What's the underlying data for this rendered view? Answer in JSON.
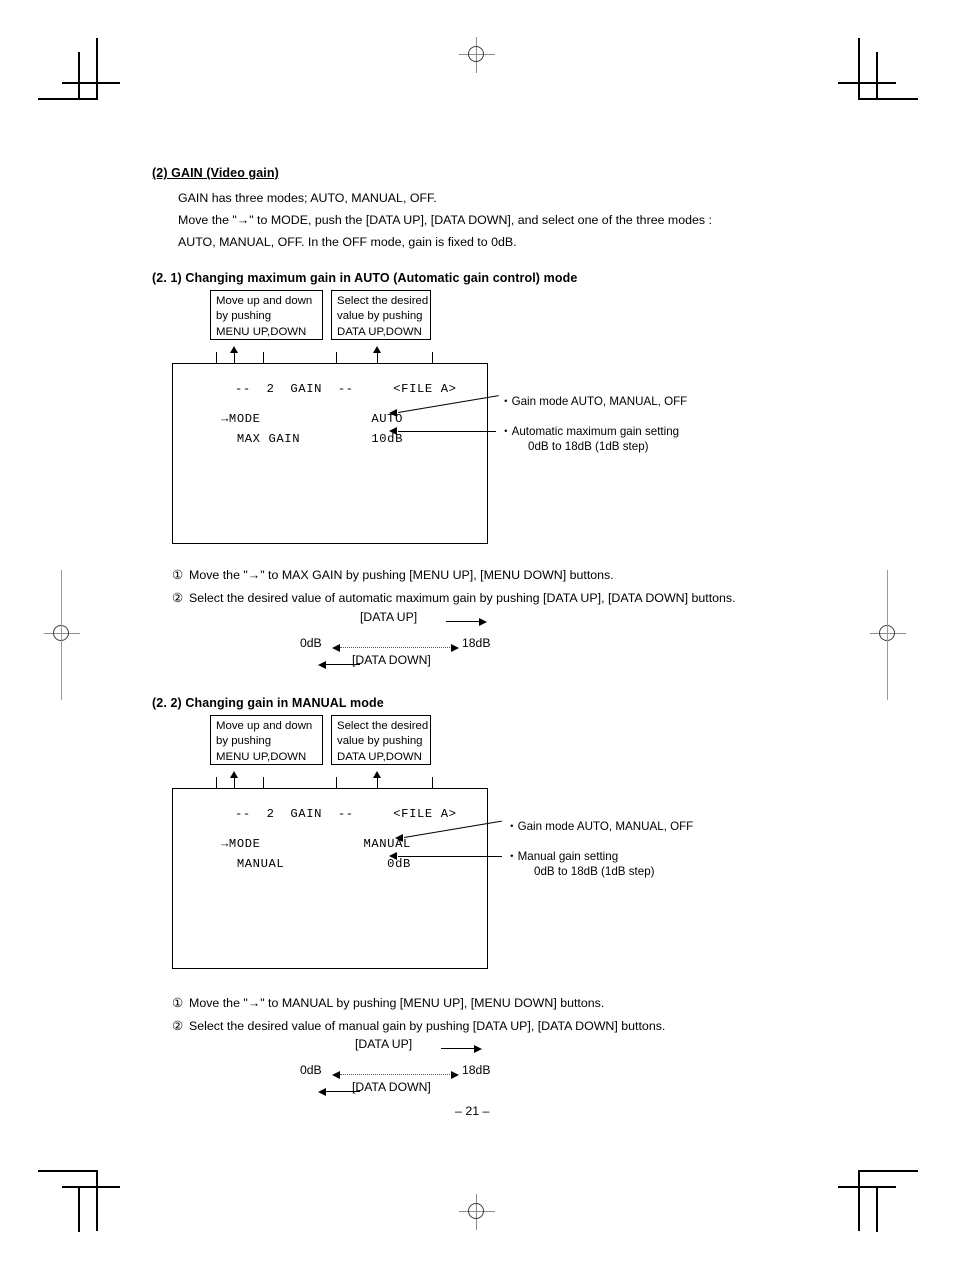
{
  "document": {
    "page_number": "– 21 –"
  },
  "section": {
    "heading": "(2)  GAIN (Video gain)",
    "lines": [
      "GAIN has three modes; AUTO, MANUAL, OFF.",
      "Move the \"→\" to MODE, push the [DATA UP], [DATA DOWN], and select one of the three modes :",
      "AUTO, MANUAL, OFF.  In the OFF mode, gain is fixed to 0dB."
    ]
  },
  "subsection_auto": {
    "heading": "(2. 1)  Changing maximum gain in AUTO (Automatic gain control) mode",
    "callout_left": {
      "line1": "Move up and down",
      "line2": "by pushing",
      "line3": "MENU UP,DOWN"
    },
    "callout_right": {
      "line1": "Select the desired",
      "line2": "value by pushing",
      "line3": "DATA UP,DOWN"
    },
    "osd": {
      "title": "--  2  GAIN  --     <FILE A>",
      "row1": "→MODE              AUTO",
      "row2": "  MAX GAIN         10dB"
    },
    "annotations": [
      {
        "text": "・Gain mode   AUTO, MANUAL, OFF",
        "sub": ""
      },
      {
        "text": "・Automatic maximum gain setting",
        "sub": "0dB to 18dB (1dB step)"
      }
    ],
    "steps": [
      {
        "num": "①",
        "text": "Move the \"→\" to MAX GAIN by pushing [MENU UP], [MENU DOWN] buttons."
      },
      {
        "num": "②",
        "text": "Select the desired value of automatic maximum gain by pushing [DATA UP], [DATA DOWN] buttons."
      }
    ],
    "range": {
      "up_label": "[DATA UP]",
      "down_label": "[DATA DOWN]",
      "min_label": "0dB",
      "max_label": "18dB"
    }
  },
  "subsection_manual": {
    "heading": "(2. 2)  Changing gain in MANUAL mode",
    "callout_left": {
      "line1": "Move up and down",
      "line2": "by pushing",
      "line3": "MENU UP,DOWN"
    },
    "callout_right": {
      "line1": "Select the desired",
      "line2": "value by pushing",
      "line3": "DATA UP,DOWN"
    },
    "osd": {
      "title": "--  2  GAIN  --     <FILE A>",
      "row1": "→MODE             MANUAL",
      "row2": "  MANUAL             0dB"
    },
    "annotations": [
      {
        "text": "・Gain mode   AUTO, MANUAL, OFF",
        "sub": ""
      },
      {
        "text": "・Manual gain setting",
        "sub": "0dB to 18dB (1dB step)"
      }
    ],
    "steps": [
      {
        "num": "①",
        "text": "Move the \"→\" to MANUAL by pushing [MENU UP], [MENU DOWN] buttons."
      },
      {
        "num": "②",
        "text": "Select the desired value of manual gain by pushing [DATA UP], [DATA DOWN] buttons."
      }
    ],
    "range": {
      "up_label": "[DATA UP]",
      "down_label": "[DATA DOWN]",
      "min_label": "0dB",
      "max_label": "18dB"
    }
  }
}
